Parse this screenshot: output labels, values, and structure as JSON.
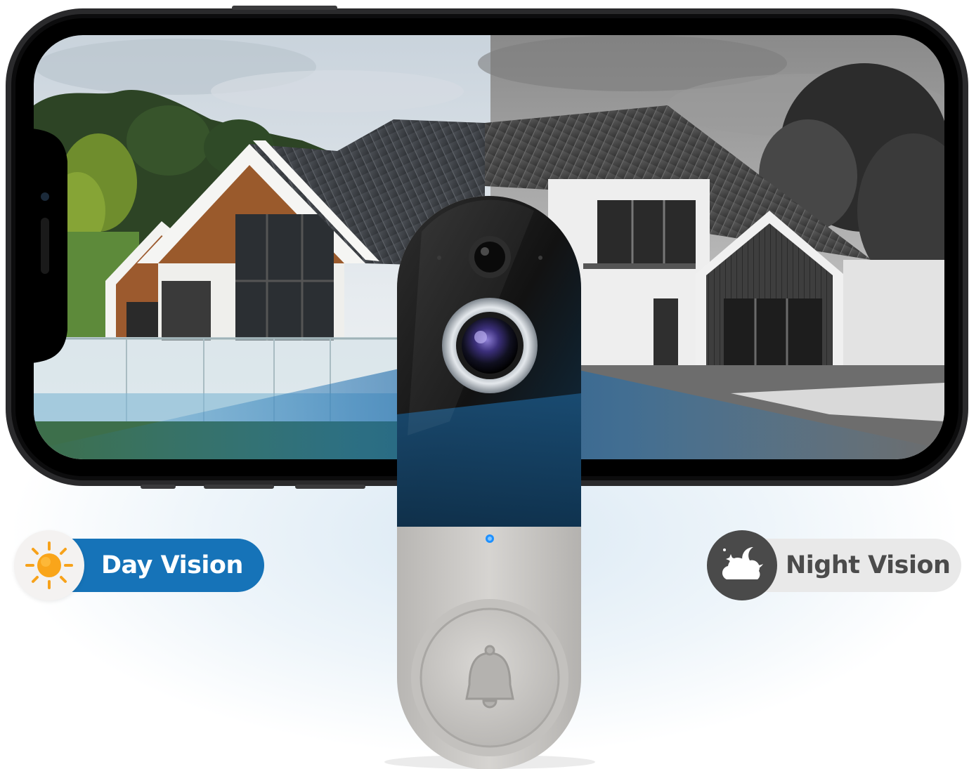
{
  "badges": {
    "day": {
      "label": "Day Vision",
      "icon": "sun-icon",
      "color": "#1673b8"
    },
    "night": {
      "label": "Night Vision",
      "icon": "moon-cloud-icon",
      "color": "#4b4b4b"
    }
  },
  "product": {
    "device": "doorbell-camera",
    "indicator_color": "#1e90ff",
    "button_icon": "bell-icon"
  },
  "phone": {
    "screen_left": "color-view",
    "screen_right": "grayscale-view"
  },
  "colors": {
    "accent_blue": "#1673b8",
    "night_gray": "#4a4a4a",
    "doorbell_silver": "#c9c7c4",
    "doorbell_black": "#1a1a1a"
  }
}
